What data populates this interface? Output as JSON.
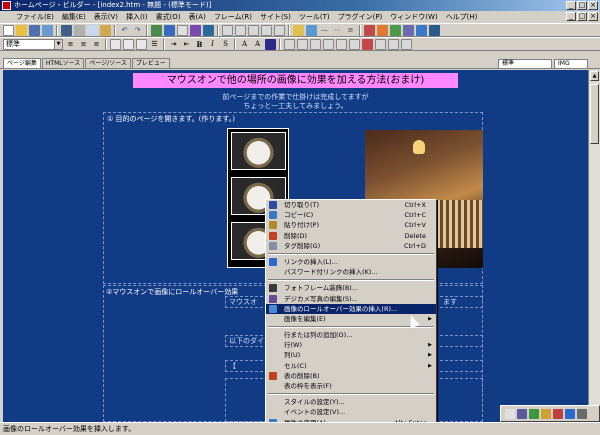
{
  "window": {
    "title": "ホームページ・ビルダー - [index2.htm - 無題 - (標準モード)]",
    "controls": [
      "_",
      "□",
      "×"
    ]
  },
  "menu": [
    "ファイル(E)",
    "編集(E)",
    "表示(V)",
    "挿入(I)",
    "書式(O)",
    "表(A)",
    "フレーム(R)",
    "サイト(S)",
    "ツール(T)",
    "プラグイン(P)",
    "ウィンドウ(W)",
    "ヘルプ(H)"
  ],
  "toolbar2": {
    "style_select": "標準"
  },
  "tabs": [
    "ページ編集",
    "HTMLソース",
    "ページ/ソース",
    "プレビュー"
  ],
  "right_selects": [
    "標準",
    "IMG"
  ],
  "page": {
    "banner": "マウスオンで他の場所の画像に効果を加える方法(おまけ)",
    "intro_line1": "前ページまでの作業で仕掛けは完成してますが",
    "intro_line2": "ちょっと一工夫してみましょう。",
    "step1": "① 目的のページを開きます。(作ります。)",
    "step2": "②マウスオンで画像にロールオーバー効果",
    "line_a": "マウスオ",
    "line_a_right": "ます",
    "line_b": "以下のダイア",
    "line_c": "【"
  },
  "context_menu": [
    {
      "label": "切り取り(T)",
      "shortcut": "Ctrl+X",
      "icon": "scissors-icon",
      "color": "#2b4aa0"
    },
    {
      "label": "コピー(C)",
      "shortcut": "Ctrl+C",
      "icon": "copy-icon",
      "color": "#3a78c8"
    },
    {
      "label": "貼り付け(P)",
      "shortcut": "Ctrl+V",
      "icon": "paste-icon",
      "color": "#b38a30"
    },
    {
      "label": "削除(D)",
      "shortcut": "Delete",
      "icon": "delete-icon",
      "color": "#c04020"
    },
    {
      "label": "タグ削除(G)",
      "shortcut": "Ctrl+D",
      "icon": "tag-delete-icon",
      "color": "#8090a8"
    },
    {
      "sep": true
    },
    {
      "label": "リンクの挿入(L)...",
      "icon": "link-icon",
      "color": "#2a6ad0"
    },
    {
      "label": "パスワード付リンクの挿入(K)...",
      "icon": "",
      "color": ""
    },
    {
      "sep": true
    },
    {
      "label": "フォトフレーム装飾(B)...",
      "icon": "photo-frame-icon",
      "color": "#3a3a3a"
    },
    {
      "label": "デジカメ写真の編集(S)...",
      "icon": "camera-icon",
      "color": "#6a4a9a"
    },
    {
      "label": "画像のロールオーバー効果の挿入(R)...",
      "icon": "rollover-icon",
      "color": "#4a8ad0",
      "highlighted": true
    },
    {
      "label": "画像を編集(E)",
      "icon": "",
      "color": "",
      "submenu": true
    },
    {
      "sep": true
    },
    {
      "label": "行または列の追加(O)...",
      "icon": "",
      "color": ""
    },
    {
      "label": "行(W)",
      "icon": "",
      "color": "",
      "submenu": true
    },
    {
      "label": "列(U)",
      "icon": "",
      "color": "",
      "submenu": true
    },
    {
      "label": "セル(C)",
      "icon": "",
      "color": "",
      "submenu": true
    },
    {
      "label": "表の削除(B)",
      "icon": "table-delete-icon",
      "color": "#c04020"
    },
    {
      "label": "表の枠を表示(F)",
      "icon": "",
      "color": ""
    },
    {
      "sep": true
    },
    {
      "label": "スタイルの設定(Y)...",
      "icon": "",
      "color": ""
    },
    {
      "label": "イベントの設定(V)...",
      "icon": "",
      "color": ""
    },
    {
      "label": "属性の変更(A)...",
      "shortcut": "Alt+Enter",
      "icon": "properties-icon",
      "color": "#3a78c8"
    }
  ],
  "status": "画像のロールオーバー効果を挿入します。",
  "colors": {
    "canvas": "#123b86",
    "banner": "#ff88ff",
    "highlight": "#0a246a"
  }
}
